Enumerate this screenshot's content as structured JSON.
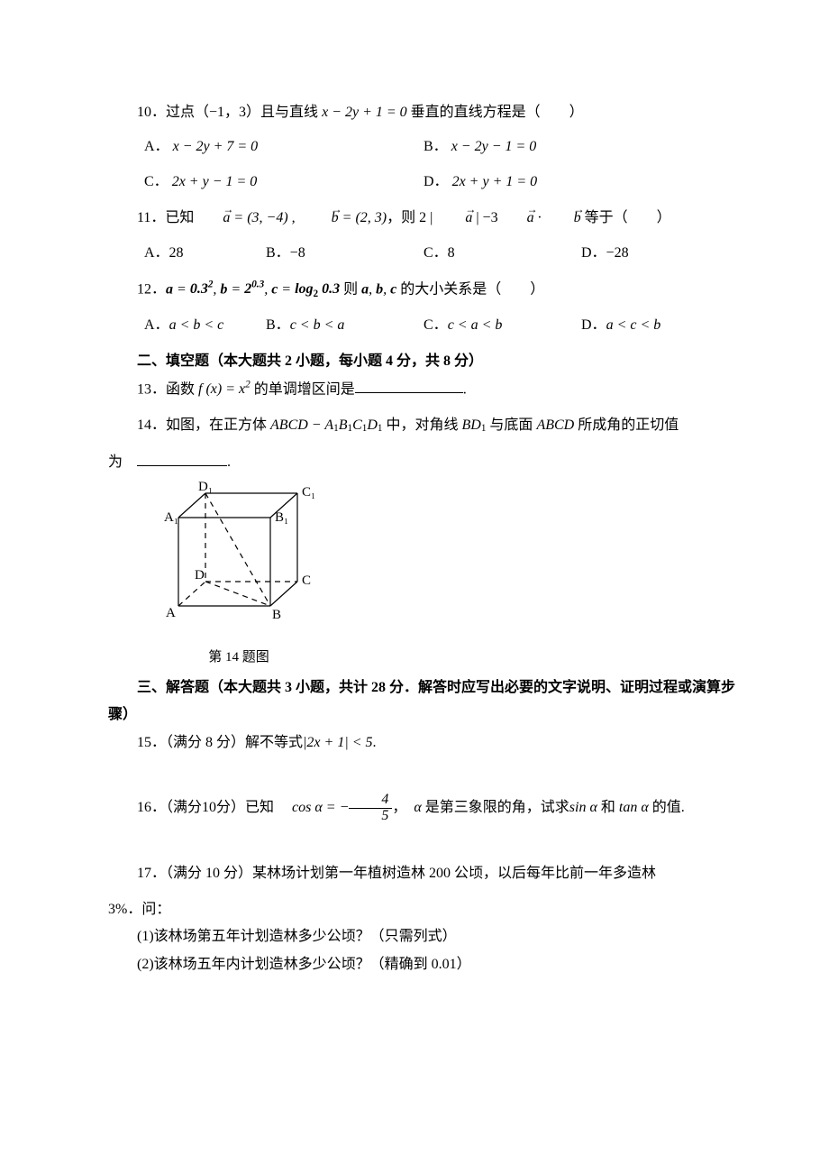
{
  "q10": {
    "stem_a": "10．过点（",
    "stem_pt": "−1，3",
    "stem_b": "）且与直线 ",
    "eq": "x − 2y + 1 = 0",
    "stem_c": " 垂直的直线方程是（　　）",
    "opts": {
      "A": "A．",
      "Aeq": "x − 2y + 7 = 0",
      "B": "B．",
      "Beq": "x − 2y − 1 = 0",
      "C": "C．",
      "Ceq": "2x + y − 1 = 0",
      "D": "D．",
      "Deq": "2x + y + 1 = 0"
    }
  },
  "q11": {
    "stem_a": "11．已知",
    "avec": "a",
    "aval": " = (3, −4) ,",
    "bvec": "b",
    "bval": " = (2, 3)",
    "stem_mid": "，则 2 | ",
    "stem_mid2": " | −3",
    "stem_dot": " · ",
    "stem_end": " 等于（　　）",
    "opts": {
      "A": "A．28",
      "B": "B．−8",
      "C": "C．8",
      "D": "D．−28"
    }
  },
  "q12": {
    "stem_a": "12．",
    "expr": "a = 0.3², b = 2⁰·³, c = log₂ 0.3",
    "stem_b": " 则 ",
    "abc": "a, b, c",
    "stem_c": " 的大小关系是（　　）",
    "opts": {
      "A": "A．a < b < c",
      "B": "B．c < b < a",
      "C": "C．c < a < b",
      "D": "D．a < c < b"
    }
  },
  "sec2_title": "二、填空题（本大题共 2 小题，每小题 4 分，共 8 分）",
  "q13": {
    "stem_a": "13．函数 ",
    "fx": "f (x) = x²",
    "stem_b": " 的单调增区间是",
    "stem_end": "."
  },
  "q14": {
    "stem_a": "14．如图，在正方体 ",
    "body": "ABCD − A₁B₁C₁D₁",
    "stem_b": " 中，对角线 ",
    "diag": "BD₁",
    "stem_c": " 与底面 ",
    "face": "ABCD",
    "stem_end": " 所成角的正切值",
    "line2_a": "为　",
    "line2_end": ".",
    "caption": "第 14 题图",
    "labels": {
      "D1": "D₁",
      "C1": "C₁",
      "A1": "A₁",
      "B1": "B₁",
      "D": "D",
      "C": "C",
      "A": "A",
      "B": "B"
    }
  },
  "sec3_title": "三、解答题（本大题共 3 小题，共计 28 分．解答时应写出必要的文字说明、证明过程或演算步骤）",
  "q15": {
    "stem_a": "15．（满分 8 分）解不等式",
    "expr": "|2x + 1| < 5",
    "stem_end": "."
  },
  "q16": {
    "stem_a": "16．（满分",
    "pts": "10",
    "stem_a2": "分）已知　",
    "cos": "cos α = −",
    "frac_num": "4",
    "frac_den": "5",
    "stem_mid": "，　α 是第三象限的角，试求",
    "sin": "sin α",
    "stem_and": " 和 ",
    "tan": "tan α",
    "stem_end": " 的值."
  },
  "q17": {
    "stem": "17．（满分 10 分）某林场计划第一年植树造林 200 公顷，以后每年比前一年多造林",
    "line2": "3%．问：",
    "p1": "(1)该林场第五年计划造林多少公顷？（只需列式）",
    "p2": "(2)该林场五年内计划造林多少公顷？（精确到 0.01）"
  }
}
